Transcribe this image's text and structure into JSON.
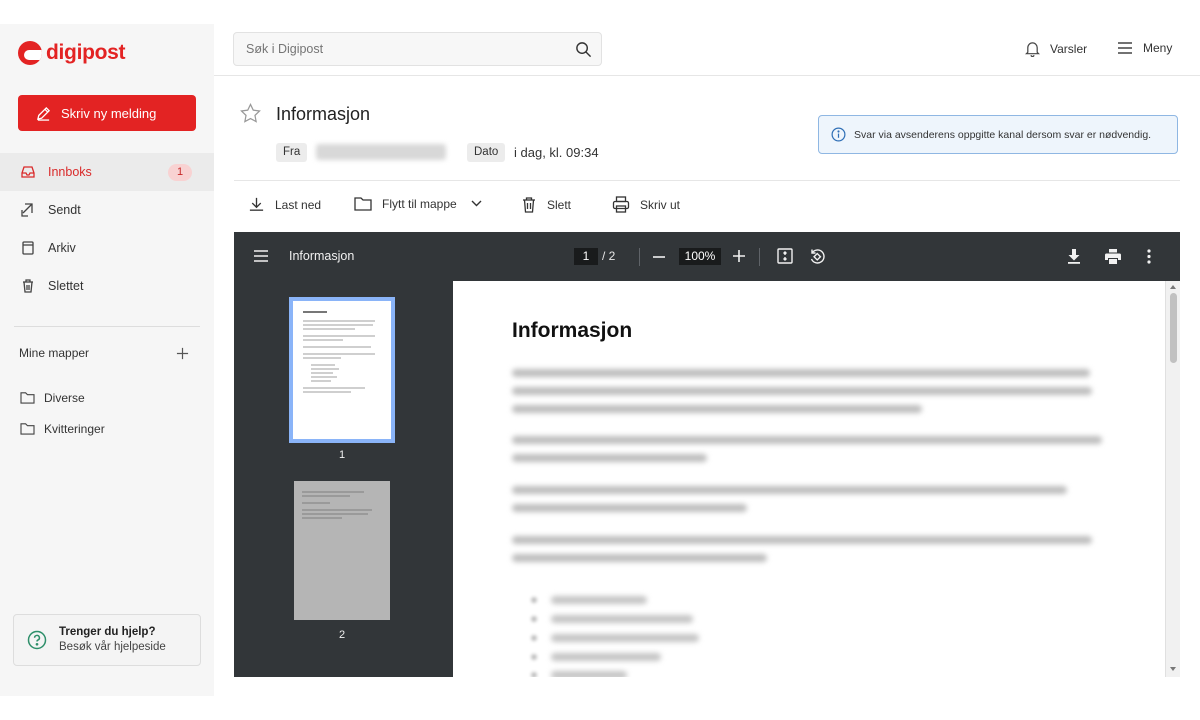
{
  "brand": {
    "name": "digipost",
    "color": "#e32323"
  },
  "sidebar": {
    "compose_label": "Skriv ny melding",
    "nav": [
      {
        "label": "Innboks",
        "icon": "inbox-icon",
        "badge": "1",
        "active": true
      },
      {
        "label": "Sendt",
        "icon": "send-icon"
      },
      {
        "label": "Arkiv",
        "icon": "archive-icon"
      },
      {
        "label": "Slettet",
        "icon": "trash-icon"
      }
    ],
    "folders_title": "Mine mapper",
    "folders": [
      {
        "label": "Diverse",
        "icon": "folder-icon"
      },
      {
        "label": "Kvitteringer",
        "icon": "folder-icon"
      }
    ],
    "help": {
      "title": "Trenger du hjelp?",
      "subtitle": "Besøk vår hjelpeside"
    }
  },
  "topbar": {
    "search_placeholder": "Søk i Digipost",
    "notifications_label": "Varsler",
    "menu_label": "Meny"
  },
  "message": {
    "title": "Informasjon",
    "from_label": "Fra",
    "date_label": "Dato",
    "date_value": "i dag, kl. 09:34",
    "notice": "Svar via avsenderens oppgitte kanal dersom svar er nødvendig."
  },
  "toolbar": {
    "download_label": "Last ned",
    "move_label": "Flytt til mappe",
    "delete_label": "Slett",
    "print_label": "Skriv ut"
  },
  "viewer": {
    "title": "Informasjon",
    "current_page": "1",
    "total_pages": "/ 2",
    "zoom": "100%",
    "thumbnails": [
      "1",
      "2"
    ],
    "page_heading": "Informasjon"
  },
  "colors": {
    "accent": "#e32323",
    "viewer_bar": "#323639",
    "viewer_bg": "#525659",
    "thumb_selected": "#8ab4f8",
    "notice_border": "#8fb7e3"
  }
}
